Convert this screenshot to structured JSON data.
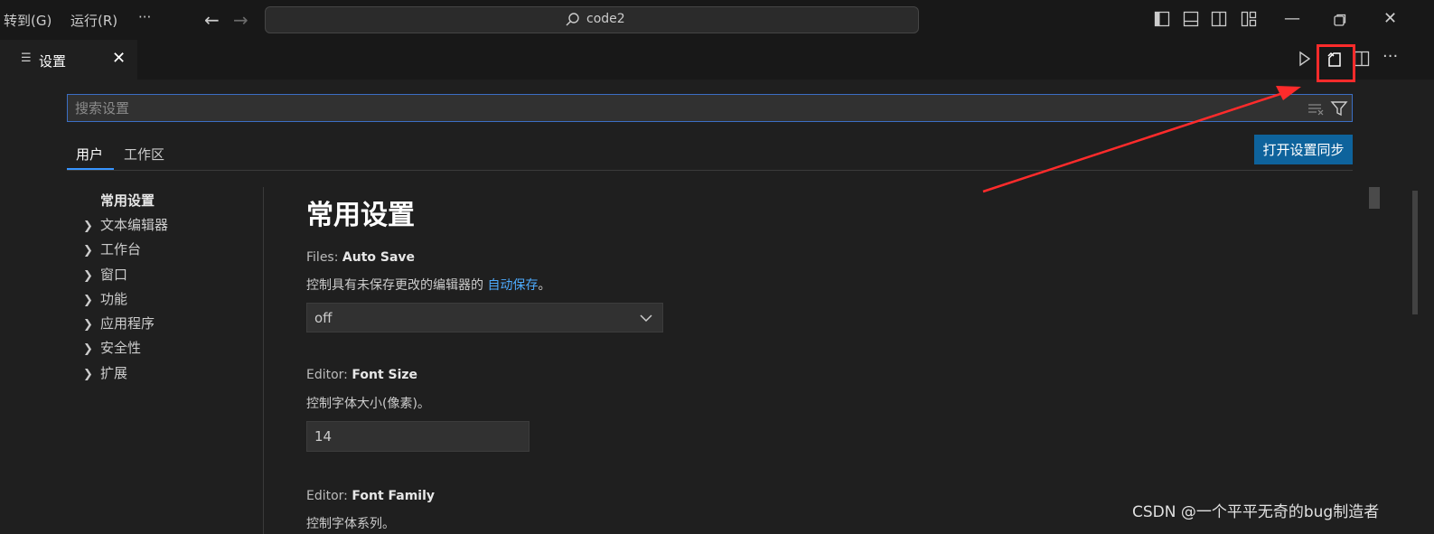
{
  "menu": {
    "goto": "转到(G)",
    "run": "运行(R)",
    "more": "···"
  },
  "command_center": {
    "text": "code2"
  },
  "tab": {
    "label": "设置",
    "icon": "settings-list-icon"
  },
  "search": {
    "placeholder": "搜索设置"
  },
  "scope_tabs": {
    "user": "用户",
    "workspace": "工作区"
  },
  "sync_button": {
    "label": "打开设置同步"
  },
  "toc": [
    {
      "label": "常用设置",
      "expandable": false
    },
    {
      "label": "文本编辑器",
      "expandable": true
    },
    {
      "label": "工作台",
      "expandable": true
    },
    {
      "label": "窗口",
      "expandable": true
    },
    {
      "label": "功能",
      "expandable": true
    },
    {
      "label": "应用程序",
      "expandable": true
    },
    {
      "label": "安全性",
      "expandable": true
    },
    {
      "label": "扩展",
      "expandable": true
    }
  ],
  "section": {
    "title": "常用设置"
  },
  "settings": {
    "auto_save": {
      "category": "Files: ",
      "name": "Auto Save",
      "desc_before": "控制具有未保存更改的编辑器的 ",
      "desc_link": "自动保存",
      "desc_after": "。",
      "value": "off"
    },
    "font_size": {
      "category": "Editor: ",
      "name": "Font Size",
      "desc": "控制字体大小(像素)。",
      "value": "14"
    },
    "font_family": {
      "category": "Editor: ",
      "name": "Font Family",
      "desc": "控制字体系列。"
    }
  },
  "watermark": "CSDN @一个平平无奇的bug制造者",
  "colors": {
    "accent": "#3794ff",
    "button": "#0e639c",
    "annotation": "#ff2b2b"
  }
}
